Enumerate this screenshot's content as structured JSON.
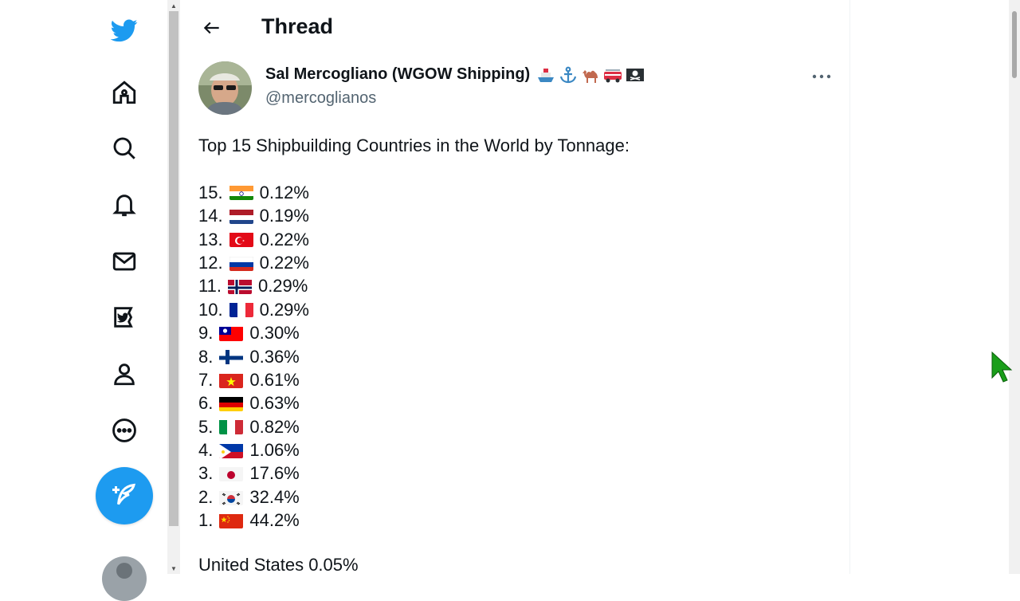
{
  "header": {
    "title": "Thread"
  },
  "author": {
    "name": "Sal Mercogliano (WGOW Shipping)",
    "handle": "@mercoglianos",
    "badges": [
      "ship-icon",
      "anchor-icon",
      "camel-icon",
      "fire-engine-icon",
      "pirate-flag-icon"
    ]
  },
  "tweet": {
    "intro": "Top 15 Shipbuilding Countries in the World by Tonnage:",
    "rankings": [
      {
        "rank": "15.",
        "flag": "india-flag-icon",
        "value": "0.12%"
      },
      {
        "rank": "14.",
        "flag": "netherlands-flag-icon",
        "value": "0.19%"
      },
      {
        "rank": "13.",
        "flag": "turkey-flag-icon",
        "value": "0.22%"
      },
      {
        "rank": "12.",
        "flag": "russia-flag-icon",
        "value": "0.22%"
      },
      {
        "rank": "11.",
        "flag": "norway-flag-icon",
        "value": "0.29%"
      },
      {
        "rank": "10.",
        "flag": "france-flag-icon",
        "value": "0.29%"
      },
      {
        "rank": "9.",
        "flag": "taiwan-flag-icon",
        "value": "0.30%"
      },
      {
        "rank": "8.",
        "flag": "finland-flag-icon",
        "value": "0.36%"
      },
      {
        "rank": "7.",
        "flag": "vietnam-flag-icon",
        "value": "0.61%"
      },
      {
        "rank": "6.",
        "flag": "germany-flag-icon",
        "value": "0.63%"
      },
      {
        "rank": "5.",
        "flag": "italy-flag-icon",
        "value": "0.82%"
      },
      {
        "rank": "4.",
        "flag": "philippines-flag-icon",
        "value": "1.06%"
      },
      {
        "rank": "3.",
        "flag": "japan-flag-icon",
        "value": "17.6%"
      },
      {
        "rank": "2.",
        "flag": "south-korea-flag-icon",
        "value": "32.4%"
      },
      {
        "rank": "1.",
        "flag": "china-flag-icon",
        "value": "44.2%"
      }
    ],
    "footer": "United States 0.05%"
  },
  "nav": {
    "icons": [
      "twitter-logo-icon",
      "home-icon",
      "search-icon",
      "notifications-icon",
      "messages-icon",
      "twitter-blue-icon",
      "profile-icon",
      "more-icon"
    ],
    "compose_icon": "compose-tweet-icon"
  },
  "colors": {
    "accent": "#1d9bf0",
    "text": "#0f1419",
    "secondary": "#536471"
  }
}
